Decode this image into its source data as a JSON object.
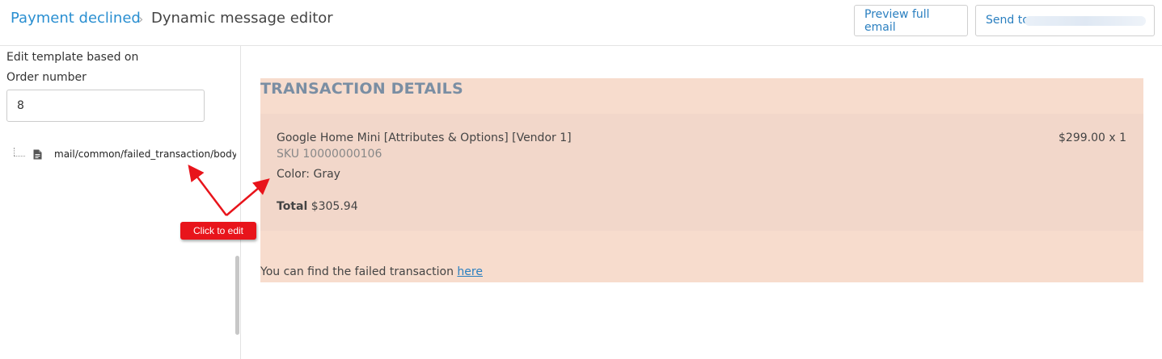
{
  "header": {
    "breadcrumb_parent": "Payment declined",
    "breadcrumb_separator": "›",
    "breadcrumb_current": "Dynamic message editor",
    "preview_button": "Preview full email",
    "send_button": "Send to"
  },
  "sidebar": {
    "edit_label": "Edit template based on",
    "order_label": "Order number",
    "order_value": "8",
    "tree_item": "mail/common/failed_transaction/body.twig",
    "file_icon": "file-icon"
  },
  "annotation": {
    "callout": "Click to edit",
    "color": "#e8141b"
  },
  "email": {
    "heading": "TRANSACTION DETAILS",
    "item_name": "Google Home Mini [Attributes & Options] [Vendor 1]",
    "item_price": "$299.00 x 1",
    "item_sku": "SKU 10000000106",
    "item_color": "Color: Gray",
    "total_label": "Total",
    "total_value": "$305.94",
    "footer_text": "You can find the failed transaction ",
    "footer_link": "here",
    "background": "#f7dccd"
  },
  "colors": {
    "link": "#2a8fd1",
    "heading": "#7a8ea3"
  }
}
